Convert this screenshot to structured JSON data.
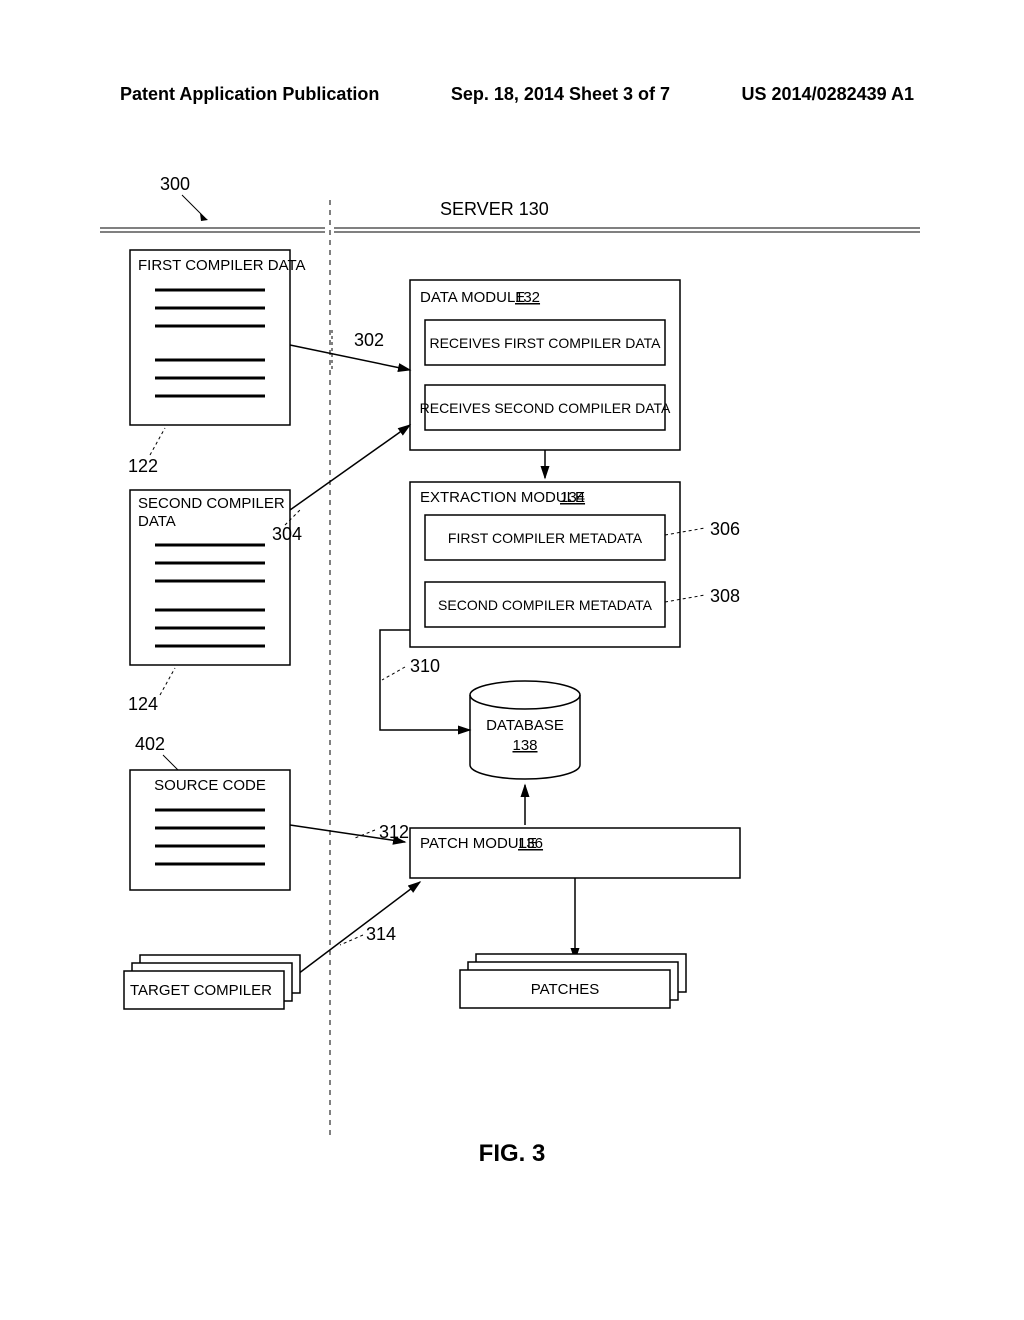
{
  "header": {
    "left": "Patent Application Publication",
    "center": "Sep. 18, 2014  Sheet 3 of 7",
    "right": "US 2014/0282439 A1"
  },
  "diagram": {
    "refnum_300": "300",
    "server_title": "SERVER 130",
    "first_compiler_data": "FIRST COMPILER DATA",
    "ref_302": "302",
    "ref_122": "122",
    "second_compiler_data_l1": "SECOND COMPILER",
    "second_compiler_data_l2": "DATA",
    "ref_304": "304",
    "ref_124": "124",
    "ref_402": "402",
    "source_code": "SOURCE CODE",
    "ref_312": "312",
    "ref_314": "314",
    "target_compiler": "TARGET COMPILER",
    "data_module": "DATA MODULE",
    "data_module_num": "132",
    "receives_first": "RECEIVES FIRST COMPILER DATA",
    "receives_second": "RECEIVES SECOND COMPILER DATA",
    "extraction_module": "EXTRACTION MODULE",
    "extraction_module_num": "134",
    "first_meta": "FIRST COMPILER METADATA",
    "ref_306": "306",
    "second_meta": "SECOND COMPILER METADATA",
    "ref_308": "308",
    "ref_310": "310",
    "database": "DATABASE",
    "database_num": "138",
    "patch_module": "PATCH MODULE",
    "patch_module_num": "136",
    "patches": "PATCHES"
  },
  "figure_label": "FIG. 3"
}
